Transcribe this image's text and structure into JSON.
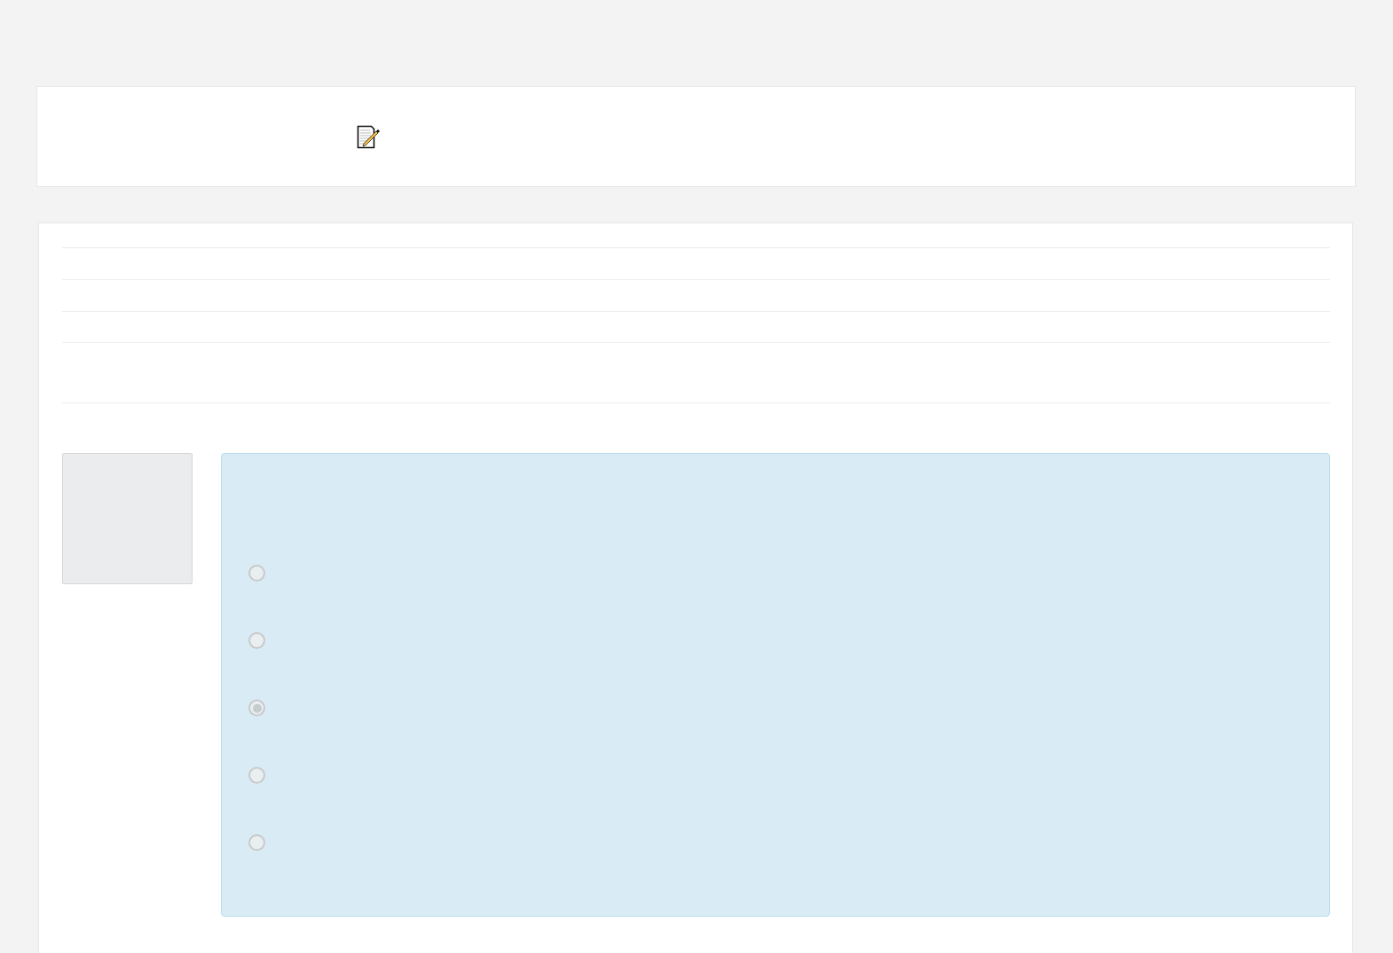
{
  "question": {
    "options": [
      {
        "selected": false
      },
      {
        "selected": false
      },
      {
        "selected": true
      },
      {
        "selected": false
      },
      {
        "selected": false
      }
    ]
  }
}
